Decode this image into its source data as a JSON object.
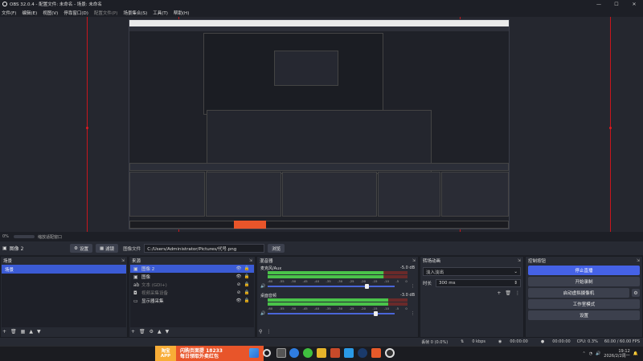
{
  "window": {
    "title": "OBS 32.0.4 - 配置文件: 未命名 - 场景: 未命名",
    "minimize": "—",
    "maximize": "☐",
    "close": "✕"
  },
  "menu": [
    "文件(F)",
    "编辑(E)",
    "视图(V)",
    "停靠窗口(D)",
    "配置文件(P)",
    "场景集合(S)",
    "工具(T)",
    "帮助(H)"
  ],
  "zoom": {
    "value": "0%",
    "label": "缩放适配窗口"
  },
  "source_bar": {
    "source_name": "图像 2",
    "properties": "设置",
    "filters": "滤镜",
    "file_label": "图像文件",
    "file_path": "C:/Users/Administrator/Pictures/代号.png",
    "browse": "浏览"
  },
  "scenes": {
    "title": "场景",
    "items": [
      {
        "name": "场景",
        "selected": true
      }
    ]
  },
  "sources": {
    "title": "来源",
    "items": [
      {
        "icon": "image-icon",
        "glyph": "▣",
        "name": "图像 2",
        "selected": true,
        "hidden": false
      },
      {
        "icon": "image-icon",
        "glyph": "▣",
        "name": "图像",
        "selected": false,
        "hidden": false
      },
      {
        "icon": "text-icon",
        "glyph": "ab",
        "name": "文本 (GDI+)",
        "selected": false,
        "hidden": true
      },
      {
        "icon": "camera-icon",
        "glyph": "◘",
        "name": "视频采集设备",
        "selected": false,
        "hidden": true
      },
      {
        "icon": "monitor-icon",
        "glyph": "▭",
        "name": "显示器采集",
        "selected": false,
        "hidden": false
      }
    ]
  },
  "mixer": {
    "title": "混音器",
    "channels": [
      {
        "name": "麦克风/Aux",
        "db": "-5.0 dB",
        "level": 0.83,
        "volume": 0.78
      },
      {
        "name": "桌面音频",
        "db": "-3.0 dB",
        "level": 0.86,
        "volume": 0.85
      }
    ],
    "ticks": [
      "-60",
      "-55",
      "-50",
      "-45",
      "-40",
      "-35",
      "-30",
      "-25",
      "-20",
      "-15",
      "-10",
      "-5",
      "0"
    ]
  },
  "transitions": {
    "title": "转场动画",
    "type": "淡入淡出",
    "duration_label": "时长",
    "duration_value": "300 ms"
  },
  "controls": {
    "title": "控制按钮",
    "buttons": [
      "停止直播",
      "开始录制",
      "启动虚拟摄像机",
      "工作室模式",
      "设置"
    ]
  },
  "status": {
    "dropped": "丢帧 0 (0.0%)",
    "kbps": "0 kbps",
    "live_time": "00:00:00",
    "rec_time": "00:00:00",
    "cpu": "CPU: 0.3%",
    "fps": "60.00 / 60.00 FPS"
  },
  "ad": {
    "badge_line1": "淘宝",
    "badge_line2": "APP",
    "line1": "闪购页面提 18233",
    "line2": "每日领取外卖红包"
  },
  "tray": {
    "time": "19:12",
    "date": "2026/2/2周一"
  },
  "colors": {
    "accent": "#3b5bd5",
    "red_guides": "#c9161c",
    "stop_button": "#4562e6"
  }
}
